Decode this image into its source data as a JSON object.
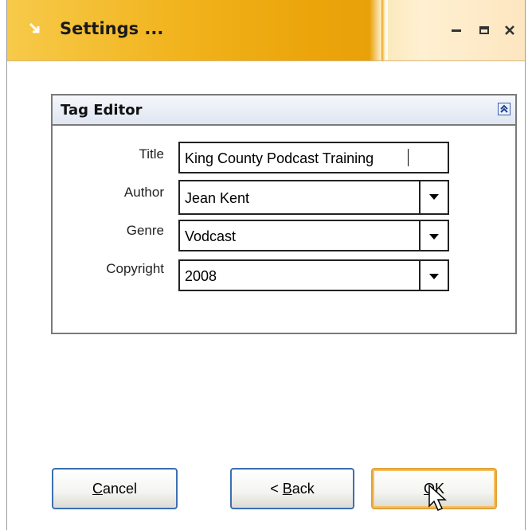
{
  "window": {
    "title": "Settings ...",
    "controls": {
      "minimize": "minimize-icon",
      "maximize": "maximize-icon",
      "close": "close-icon"
    }
  },
  "panel": {
    "title": "Tag Editor",
    "fields": [
      {
        "label": "Title",
        "value": "King County Podcast Training",
        "type": "text"
      },
      {
        "label": "Author",
        "value": "Jean Kent",
        "type": "combo"
      },
      {
        "label": "Genre",
        "value": "Vodcast",
        "type": "combo"
      },
      {
        "label": "Copyright",
        "value": "2008",
        "type": "combo"
      }
    ]
  },
  "buttons": {
    "cancel": {
      "accel": "C",
      "rest": "ancel"
    },
    "back": {
      "prefix": "< ",
      "accel": "B",
      "rest": "ack"
    },
    "ok": {
      "accel": "O",
      "rest": "K"
    }
  },
  "colors": {
    "titlebar_accent": "#f1b21b",
    "button_border": "#3c6fb2",
    "default_button_border": "#e0a23a"
  }
}
